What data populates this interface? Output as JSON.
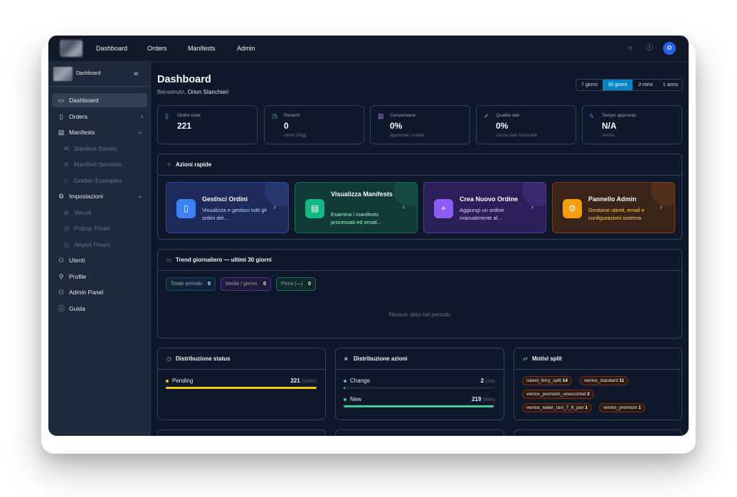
{
  "topbar": {
    "nav": [
      "Dashboard",
      "Orders",
      "Manifests",
      "Admin"
    ],
    "avatar_initial": "O",
    "icons": [
      "sun-icon",
      "info-icon"
    ]
  },
  "sidebar": {
    "title": "Dashboard",
    "items": [
      {
        "label": "Dashboard",
        "icon": "folder-icon",
        "active": true
      },
      {
        "label": "Orders",
        "icon": "clipboard-icon",
        "chevron": ">"
      },
      {
        "label": "Manifests",
        "icon": "document-icon",
        "chevron": "v"
      },
      {
        "label": "Manifest Emails",
        "icon": "mail-icon",
        "sub": true
      },
      {
        "label": "Manifest Services",
        "icon": "list-icon",
        "sub": true
      },
      {
        "label": "Golden Examples",
        "icon": "star-icon",
        "sub": true
      },
      {
        "label": "Impostazioni",
        "icon": "gear-icon",
        "chevron": "v"
      },
      {
        "label": "Veicoli",
        "icon": "car-icon",
        "sub": true
      },
      {
        "label": "Pickup Times",
        "icon": "clock-icon",
        "sub": true
      },
      {
        "label": "Airport Hours",
        "icon": "clock-icon",
        "sub": true
      },
      {
        "label": "Utenti",
        "icon": "users-icon"
      },
      {
        "label": "Profile",
        "icon": "user-icon"
      },
      {
        "label": "Admin Panel",
        "icon": "admin-icon"
      },
      {
        "label": "Guida",
        "icon": "info-icon"
      }
    ]
  },
  "header": {
    "title": "Dashboard",
    "welcome_prefix": "Benvenuto,",
    "user_name": "Orion Stanchieri",
    "ranges": [
      "7 giorni",
      "30 giorni",
      "3 mesi",
      "1 anno"
    ],
    "selected_range": "30 giorni"
  },
  "stats": [
    {
      "label": "Ordini totali",
      "value": "221",
      "sub": "",
      "icon": "clipboard-icon",
      "color": "#38bdf8"
    },
    {
      "label": "Recenti",
      "value": "0",
      "sub": "ultimi 30gg",
      "icon": "clock-icon",
      "color": "#34d399"
    },
    {
      "label": "Conversione",
      "value": "0%",
      "sub": "approvati / totale",
      "icon": "bar-chart-icon",
      "color": "#a78bfa"
    },
    {
      "label": "Qualità dati",
      "value": "0%",
      "sub": "senza dati mancanti",
      "icon": "check-circle-icon",
      "color": "#facc15"
    },
    {
      "label": "Tempo approvaz.",
      "value": "N/A",
      "sub": "media",
      "icon": "bolt-icon",
      "color": "#818cf8"
    }
  ],
  "quick_actions": {
    "title": "Azioni rapide",
    "items": [
      {
        "title": "Gestisci Ordini",
        "desc": "Visualizza e gestisci tutti gli ordini del...",
        "color": "#3b82f6"
      },
      {
        "title": "Visualizza Manifests",
        "desc": "Esamina i manifests processati ed email...",
        "color": "#10b981"
      },
      {
        "title": "Crea Nuovo Ordine",
        "desc": "Aggiungi un ordine manualmente al...",
        "color": "#8b5cf6"
      },
      {
        "title": "Pannello Admin",
        "desc": "Gestione utenti, email e configurazioni sistema",
        "color": "#f59e0b"
      }
    ]
  },
  "trend": {
    "title": "Trend giornaliero — ultimi 30 giorni",
    "pills": [
      {
        "label": "Totale periodo",
        "value": "0"
      },
      {
        "label": "Media / giorno",
        "value": "0"
      },
      {
        "label": "Picco (—)",
        "value": "0"
      }
    ],
    "empty": "Nessun dato nel periodo"
  },
  "status_dist": {
    "title": "Distribuzione status",
    "rows": [
      {
        "label": "Pending",
        "value": "221",
        "pct": "(100%)",
        "fraction": 1.0,
        "color": "#facc15"
      }
    ]
  },
  "action_dist": {
    "title": "Distribuzione azioni",
    "rows": [
      {
        "label": "Change",
        "value": "2",
        "pct": "(1%)",
        "fraction": 0.01,
        "color": "#60a5fa"
      },
      {
        "label": "New",
        "value": "219",
        "pct": "(99%)",
        "fraction": 0.99,
        "color": "#34d399"
      }
    ]
  },
  "split": {
    "title": "Motivi split",
    "tags": [
      {
        "label": "island_ferry_split",
        "count": "14"
      },
      {
        "label": "venice_standard",
        "count": "11"
      },
      {
        "label": "venice_premium_unescorted",
        "count": "2"
      },
      {
        "label": "venice_water_taxi_7_8_pax",
        "count": "1"
      },
      {
        "label": "venice_premium",
        "count": "1"
      }
    ]
  }
}
